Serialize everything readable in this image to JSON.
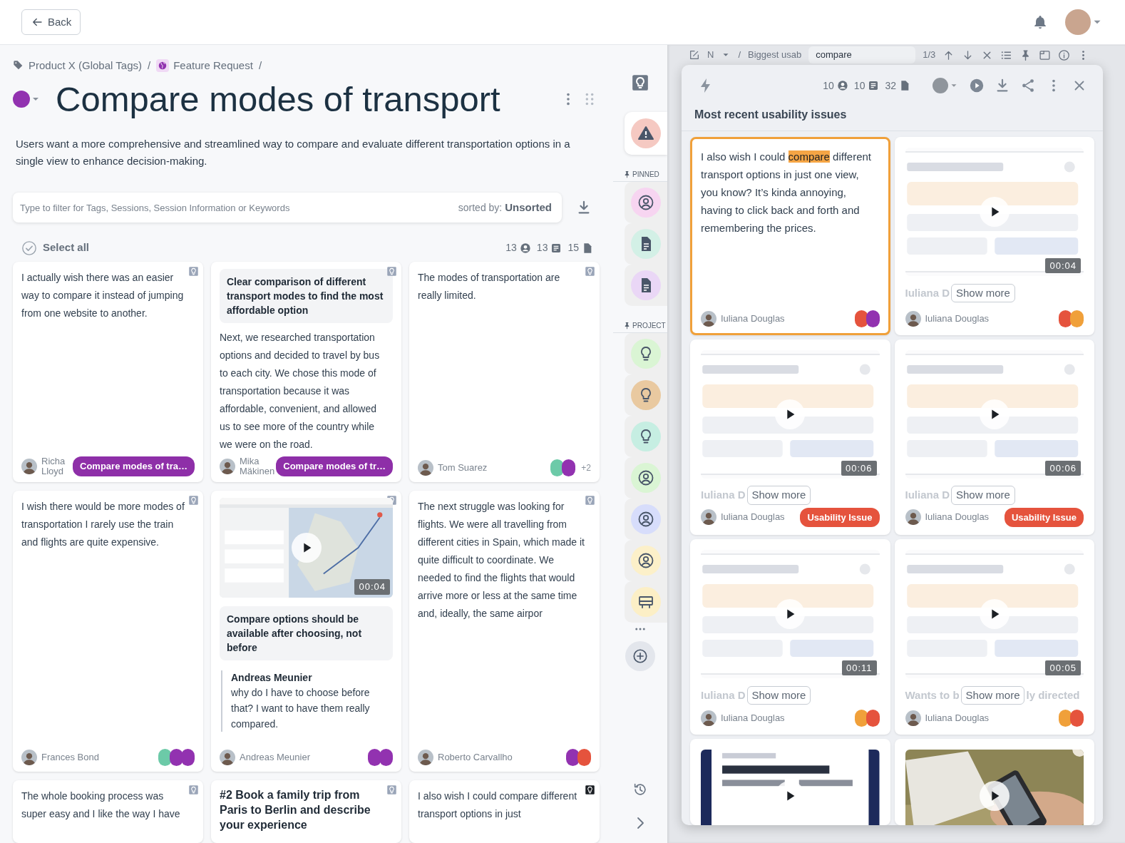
{
  "topbar": {
    "back_label": "Back"
  },
  "breadcrumb": [
    {
      "label": "Product X (Global Tags)",
      "kind": "tag",
      "sep": "/"
    },
    {
      "label": "Feature Request",
      "kind": "globe",
      "sep": "/"
    }
  ],
  "title": "Compare modes of transport",
  "description": "Users want a more comprehensive and streamlined way to compare and evaluate different transportation options in a single view to enhance decision-making.",
  "filter": {
    "placeholder": "Type to filter for Tags, Sessions, Session Information or Keywords",
    "sort_label": "sorted by:",
    "sort_value": "Unsorted"
  },
  "select_all": {
    "label": "Select all",
    "checked": false
  },
  "counts": [
    {
      "value": "13",
      "kind": "person"
    },
    {
      "value": "13",
      "kind": "note"
    },
    {
      "value": "15",
      "kind": "file"
    }
  ],
  "cards": [
    {
      "kind": "quote",
      "highlighted": false,
      "text": "I actually wish there was an easier way to compare it instead of jumping from one website to another.",
      "author": "Richa Lloyd",
      "tag": "Compare modes of tra…"
    },
    {
      "kind": "insight",
      "highlighted": false,
      "insight": "Clear comparison of different transport modes to find the most affordable option",
      "text": "Next, we researched transportation options and decided to travel by bus to each city. We chose this mode of transportation because it was affordable, convenient, and allowed us to see more of the country while we were on the road.",
      "author": "Mika Mäkinen",
      "tag": "Compare modes of tr…"
    },
    {
      "kind": "quote",
      "highlighted": false,
      "text": "The modes of transportation are really limited.",
      "author": "Tom Suarez",
      "tags": [
        {
          "color": "#6ccaa8"
        },
        {
          "color": "#9232b0"
        }
      ],
      "extra": "+2"
    },
    {
      "kind": "quote",
      "highlighted": false,
      "text": "I wish there would be more modes of transportation I rarely use the train and flights are quite expensive.",
      "author": "Frances Bond",
      "tags": [
        {
          "color": "#6ccaa8"
        },
        {
          "color": "#9232b0"
        },
        {
          "color": "#9232b0"
        }
      ]
    },
    {
      "kind": "video",
      "highlighted": false,
      "duration": "00:04",
      "insight": "Compare options should be available after choosing, not before",
      "comment": {
        "author": "Andreas Meunier",
        "text": "why do I have to choose before that? I want to have them really compared."
      },
      "author": "Andreas Meunier",
      "tags": [
        {
          "color": "#9232b0"
        },
        {
          "color": "#9232b0"
        }
      ]
    },
    {
      "kind": "quote",
      "highlighted": false,
      "text": "The next struggle was looking for flights. We were all travelling from different cities in Spain, which made it quite difficult to coordinate. We needed to find the flights that would arrive more or less at the same time and, ideally, the same airpor",
      "author": "Roberto Carvallho",
      "tags": [
        {
          "color": "#9232b0"
        },
        {
          "color": "#e5533d"
        }
      ]
    },
    {
      "kind": "quote",
      "highlighted": false,
      "text": "The whole booking process was super easy and I like the way I have"
    },
    {
      "kind": "title",
      "highlighted": false,
      "title": "#2 Book a family trip from Paris to Berlin and describe your experience"
    },
    {
      "kind": "quote",
      "highlighted": true,
      "text": "I also wish I could compare different transport options in just"
    }
  ],
  "rail": {
    "sections": [
      {
        "items": [
          {
            "kind": "warning",
            "color": "#f5c9c2",
            "selected": true
          }
        ]
      },
      {
        "label": "PINNED",
        "items": [
          {
            "kind": "person",
            "color": "#f7d5f1",
            "selected": false
          },
          {
            "kind": "document",
            "color": "#d3f0e6",
            "selected": false
          },
          {
            "kind": "document",
            "color": "#ead7f6",
            "selected": false
          }
        ]
      },
      {
        "label": "PROJECT",
        "items": [
          {
            "kind": "bulb",
            "color": "#daf5d4",
            "selected": false
          },
          {
            "kind": "bulb",
            "color": "#e9c9a0",
            "selected": false
          },
          {
            "kind": "bulb",
            "color": "#c6eee2",
            "selected": false
          },
          {
            "kind": "person",
            "color": "#daf5d4",
            "selected": false
          },
          {
            "kind": "person",
            "color": "#d7ddfb",
            "selected": false
          },
          {
            "kind": "person",
            "color": "#fcf0c9",
            "selected": false
          },
          {
            "kind": "board",
            "color": "#fcefc6",
            "selected": false
          }
        ]
      }
    ]
  },
  "background_toolbar": {
    "item": "N",
    "sep": "/",
    "path": "Biggest usab",
    "search": "compare",
    "match_count": "1/3"
  },
  "panel": {
    "counts": [
      {
        "value": "10",
        "kind": "person"
      },
      {
        "value": "10",
        "kind": "note"
      },
      {
        "value": "32",
        "kind": "file"
      }
    ],
    "title": "Most recent usability issues",
    "cards": [
      {
        "kind": "quote",
        "selected": true,
        "text_before": "I also wish I could ",
        "highlight": "compare",
        "text_after": " different transport options in just one view, you know? It’s kinda annoying, having to click back and forth and remembering the prices.",
        "author": "Iuliana Douglas",
        "tags": [
          {
            "color": "#e5533d"
          },
          {
            "color": "#9232b0"
          }
        ]
      },
      {
        "kind": "video",
        "selected": false,
        "duration": "00:04",
        "preview": "Iuliana D",
        "more_label": "Show more",
        "author": "Iuliana Douglas",
        "tags": [
          {
            "color": "#e5533d"
          },
          {
            "color": "#f0a03a"
          }
        ]
      },
      {
        "kind": "video",
        "selected": false,
        "duration": "00:06",
        "preview": "Iuliana D",
        "more_label": "Show more",
        "author": "Iuliana Douglas",
        "tag": "Usability Issue"
      },
      {
        "kind": "video",
        "selected": false,
        "duration": "00:06",
        "preview": "Iuliana D",
        "more_label": "Show more",
        "author": "Iuliana Douglas",
        "tag": "Usability Issue"
      },
      {
        "kind": "video",
        "selected": false,
        "duration": "00:11",
        "preview": "Iuliana D",
        "more_label": "Show more",
        "author": "Iuliana Douglas",
        "tags": [
          {
            "color": "#f0a03a"
          },
          {
            "color": "#e5533d"
          }
        ]
      },
      {
        "kind": "video",
        "selected": false,
        "duration": "00:05",
        "preview": "Wants to b",
        "preview_after": "ly directed",
        "more_label": "Show more",
        "author": "Iuliana Douglas",
        "tags": [
          {
            "color": "#f0a03a"
          },
          {
            "color": "#e5533d"
          }
        ]
      },
      {
        "kind": "video",
        "selected": false
      },
      {
        "kind": "video",
        "selected": false
      }
    ]
  }
}
